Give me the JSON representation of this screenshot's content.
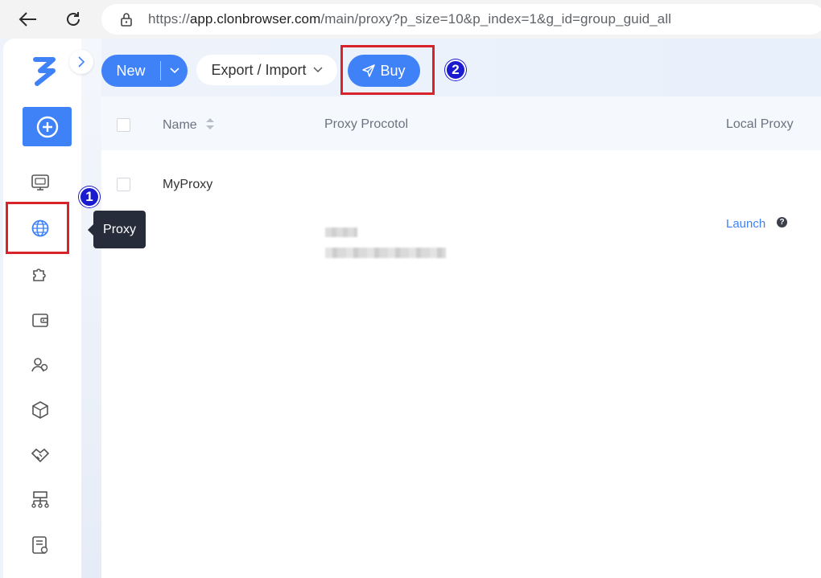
{
  "browser": {
    "url_prefix": "https://",
    "url_host": "app.clonbrowser.com",
    "url_path": "/main/proxy?p_size=10&p_index=1&g_id=group_guid_all"
  },
  "toolbar": {
    "new_label": "New",
    "export_label": "Export / Import",
    "buy_label": "Buy"
  },
  "sidebar": {
    "tooltip": "Proxy",
    "items": [
      "profiles-icon",
      "proxy-icon",
      "extensions-icon",
      "wallet-icon",
      "team-icon",
      "package-icon",
      "affiliate-icon",
      "api-icon",
      "logs-icon"
    ]
  },
  "annotations": {
    "step1": "1",
    "step2": "2",
    "highlight_color": "#d9232a",
    "badge_color": "#1a1acf"
  },
  "table": {
    "columns": [
      "Name",
      "Proxy Procotol",
      "Local Proxy"
    ],
    "rows": [
      {
        "name": "MyProxy",
        "local_proxy_action": "Launch",
        "help": "?"
      }
    ]
  },
  "colors": {
    "accent": "#3f82f7",
    "tooltip_bg": "#262c3a"
  }
}
